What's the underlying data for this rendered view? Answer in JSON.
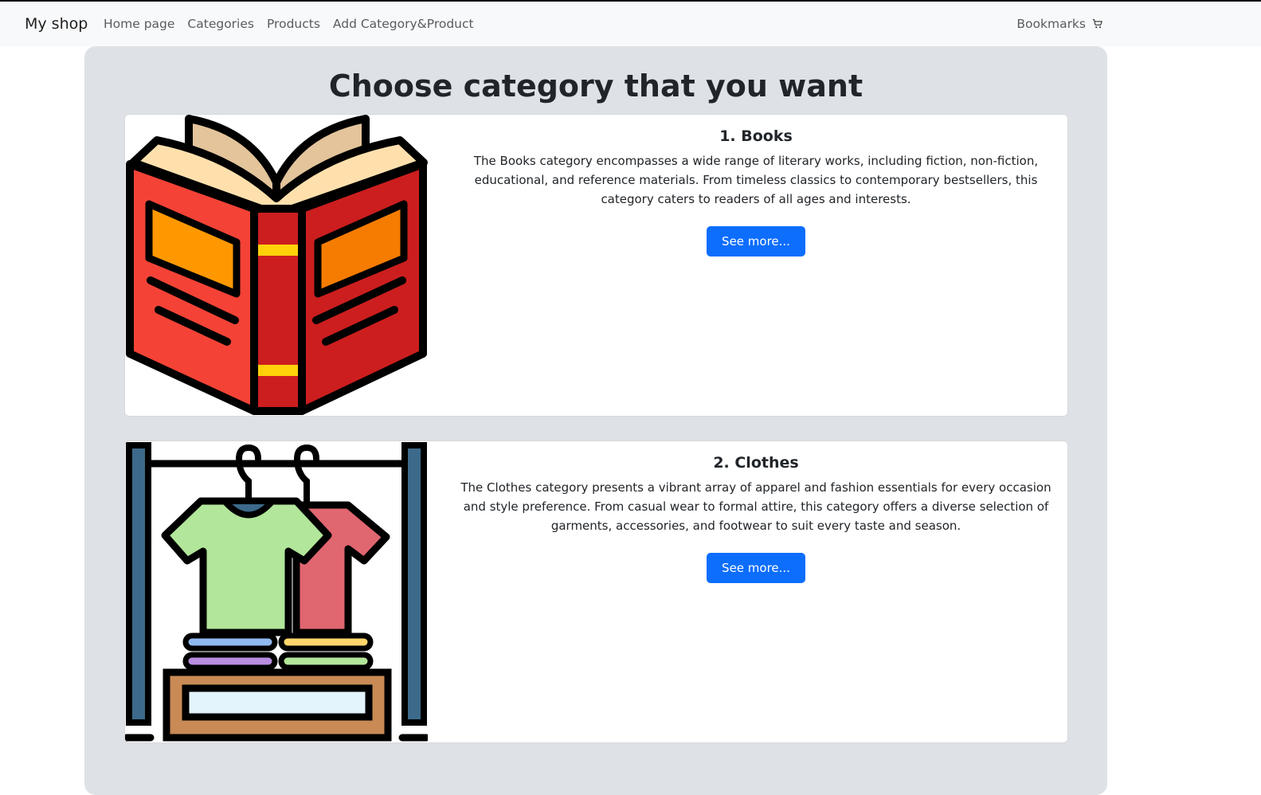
{
  "navbar": {
    "brand": "My shop",
    "links": [
      "Home page",
      "Categories",
      "Products",
      "Add Category&Product"
    ],
    "bookmarks_label": "Bookmarks",
    "bookmarks_icon": "cart-icon"
  },
  "main": {
    "title": "Choose category that you want",
    "categories": [
      {
        "title": "1. Books",
        "description": "The Books category encompasses a wide range of literary works, including fiction, non-fiction, educational, and reference materials. From timeless classics to contemporary bestsellers, this category caters to readers of all ages and interests.",
        "button_label": "See more...",
        "icon": "open-book-icon"
      },
      {
        "title": "2. Clothes",
        "description": "The Clothes category presents a vibrant array of apparel and fashion essentials for every occasion and style preference. From casual wear to formal attire, this category offers a diverse selection of garments, accessories, and footwear to suit every taste and season.",
        "button_label": "See more...",
        "icon": "clothes-rack-icon"
      }
    ]
  },
  "colors": {
    "accent": "#0d6efd",
    "navbar_bg": "#f8f9fa",
    "panel_bg": "#dee2e6"
  }
}
